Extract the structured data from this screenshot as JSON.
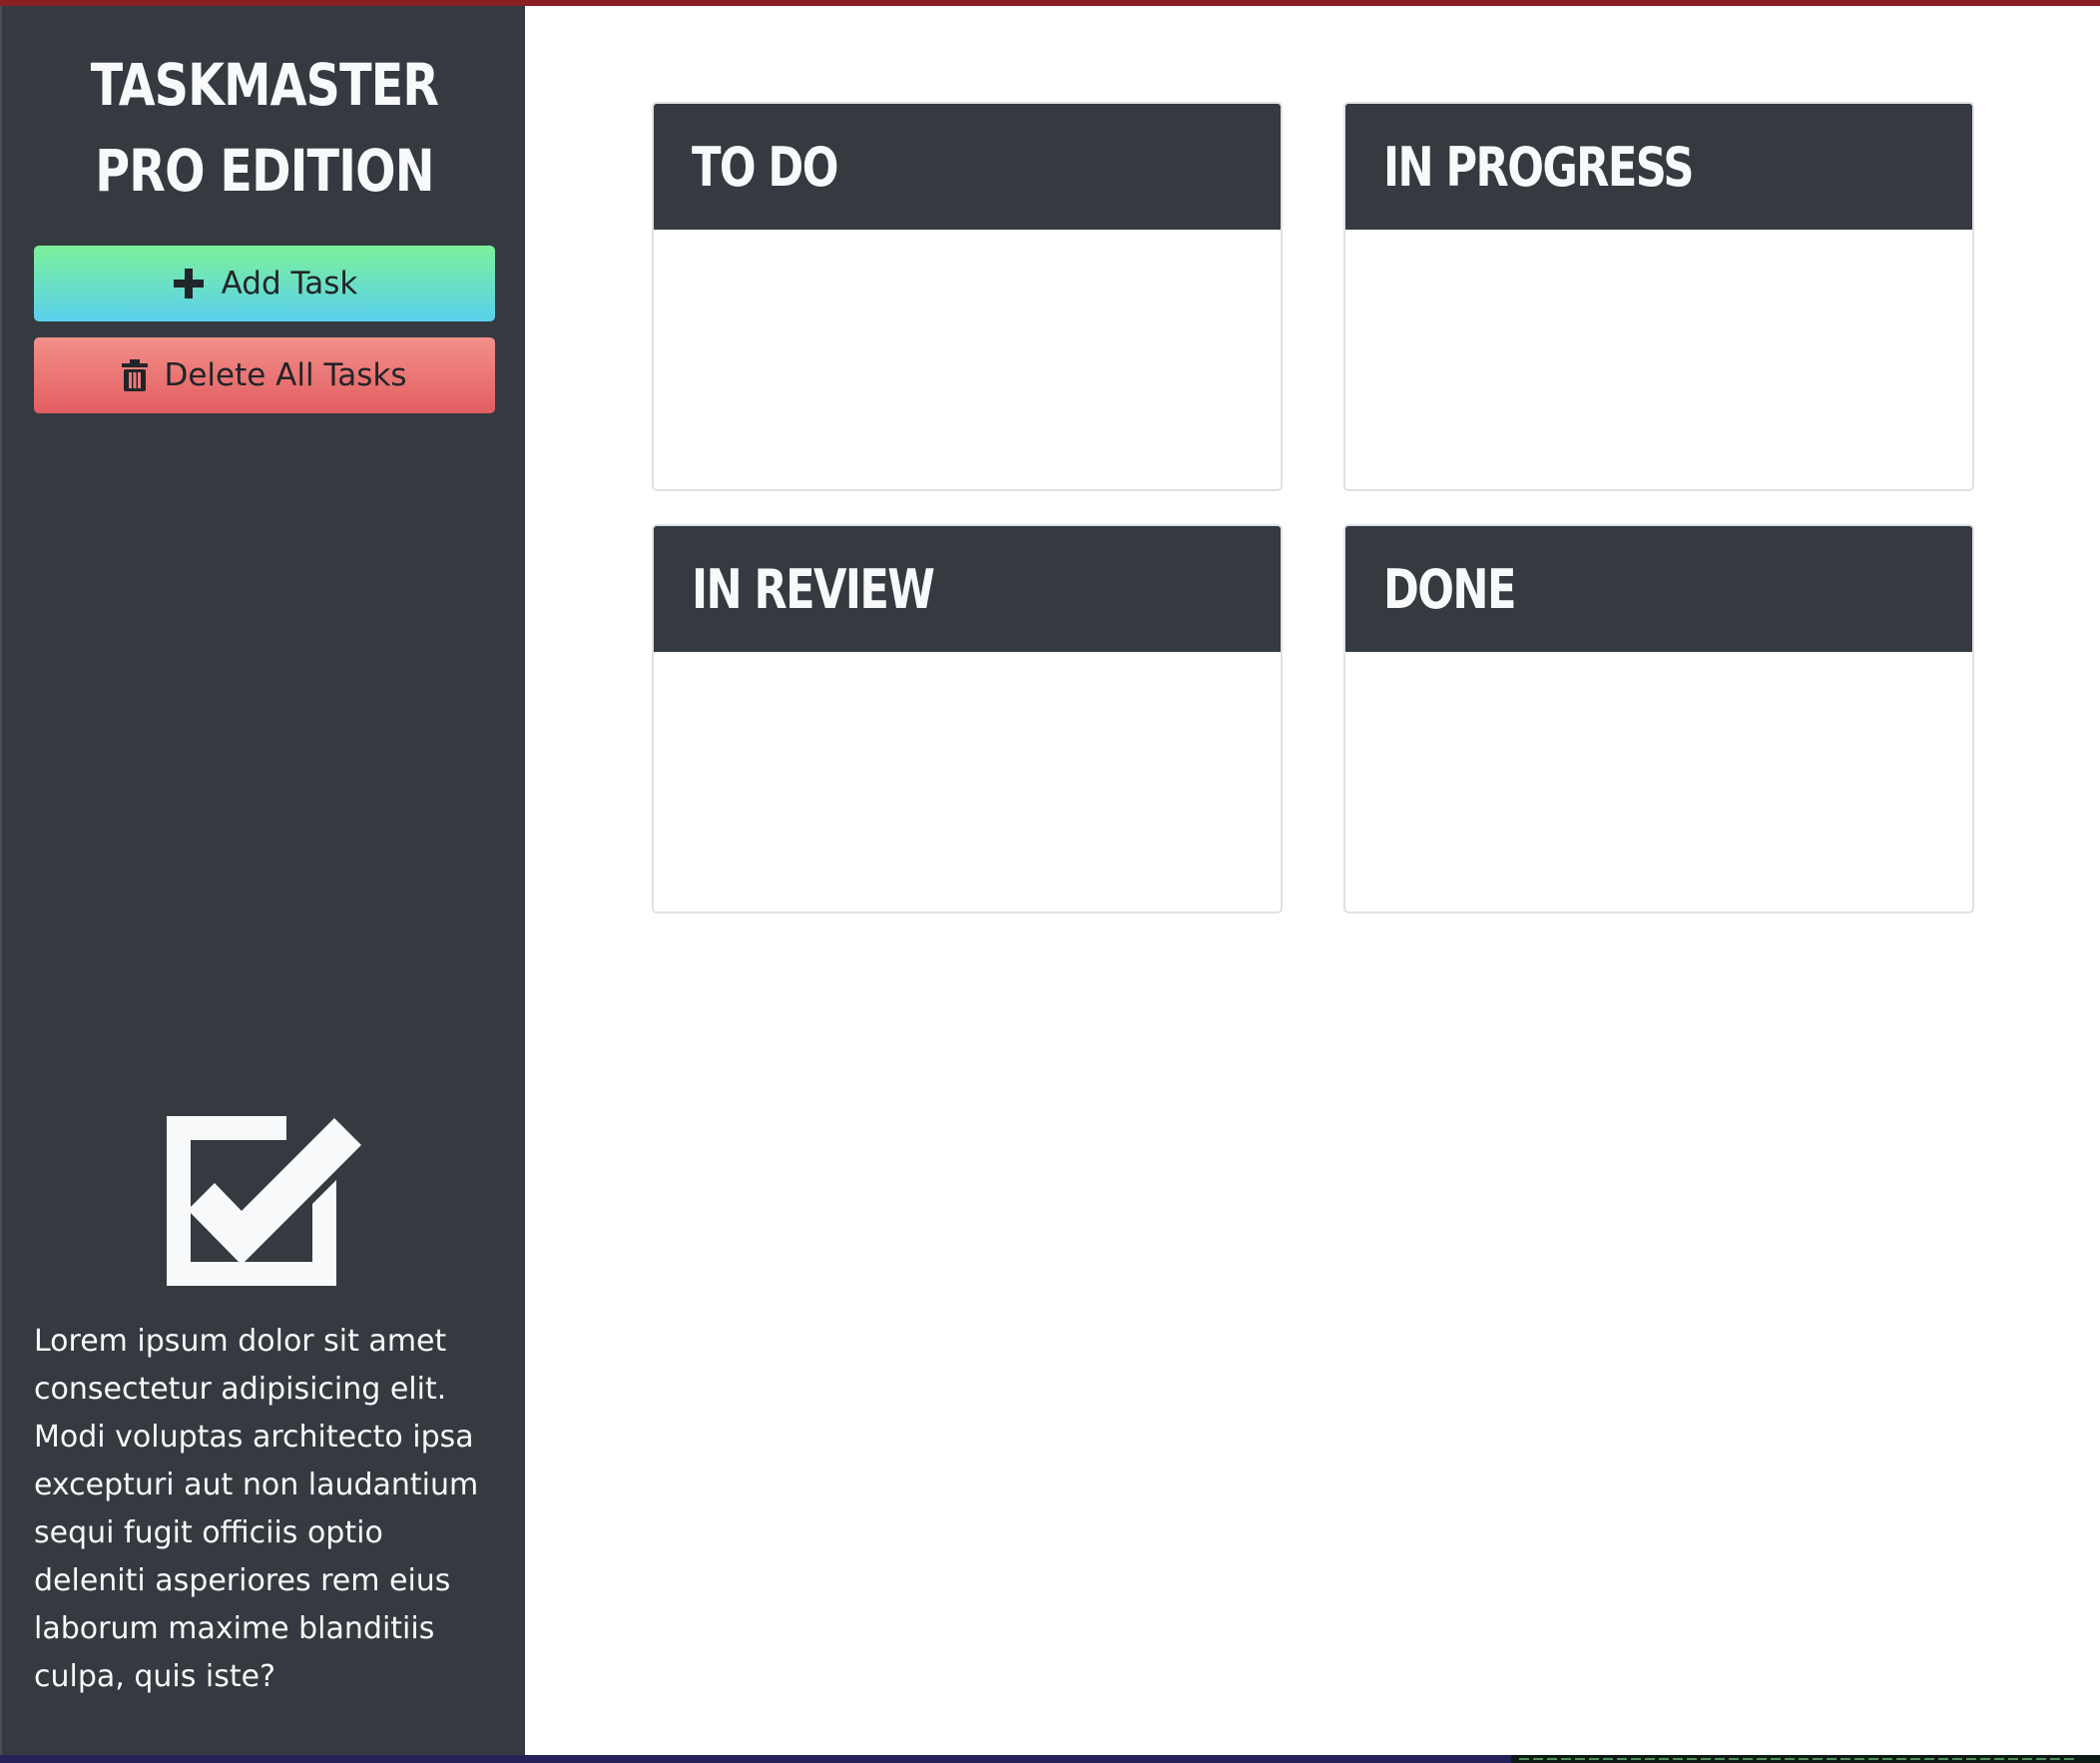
{
  "sidebar": {
    "title_line1": "TASKMASTER",
    "title_line2": "PRO EDITION",
    "add_button_label": "Add Task",
    "add_button_icon": "plus-icon",
    "delete_button_label": "Delete All Tasks",
    "delete_button_icon": "trash-icon",
    "logo_icon": "checkbox-checked-icon",
    "description": "Lorem ipsum dolor sit amet consectetur adipisicing elit. Modi voluptas architecto ipsa excepturi aut non laudantium sequi fugit officiis optio deleniti asperiores rem eius laborum maxime blanditiis culpa, quis iste?"
  },
  "board": {
    "columns": [
      {
        "title": "TO DO",
        "tasks": []
      },
      {
        "title": "IN PROGRESS",
        "tasks": []
      },
      {
        "title": "IN REVIEW",
        "tasks": []
      },
      {
        "title": "DONE",
        "tasks": []
      }
    ]
  },
  "colors": {
    "sidebar_bg": "#343a40",
    "header_bg": "#343a40",
    "text_light": "#f8f9fa",
    "add_gradient_top": "#7cf09a",
    "add_gradient_bottom": "#5ad0ee",
    "delete_gradient_top": "#f29089",
    "delete_gradient_bottom": "#e35d62"
  }
}
